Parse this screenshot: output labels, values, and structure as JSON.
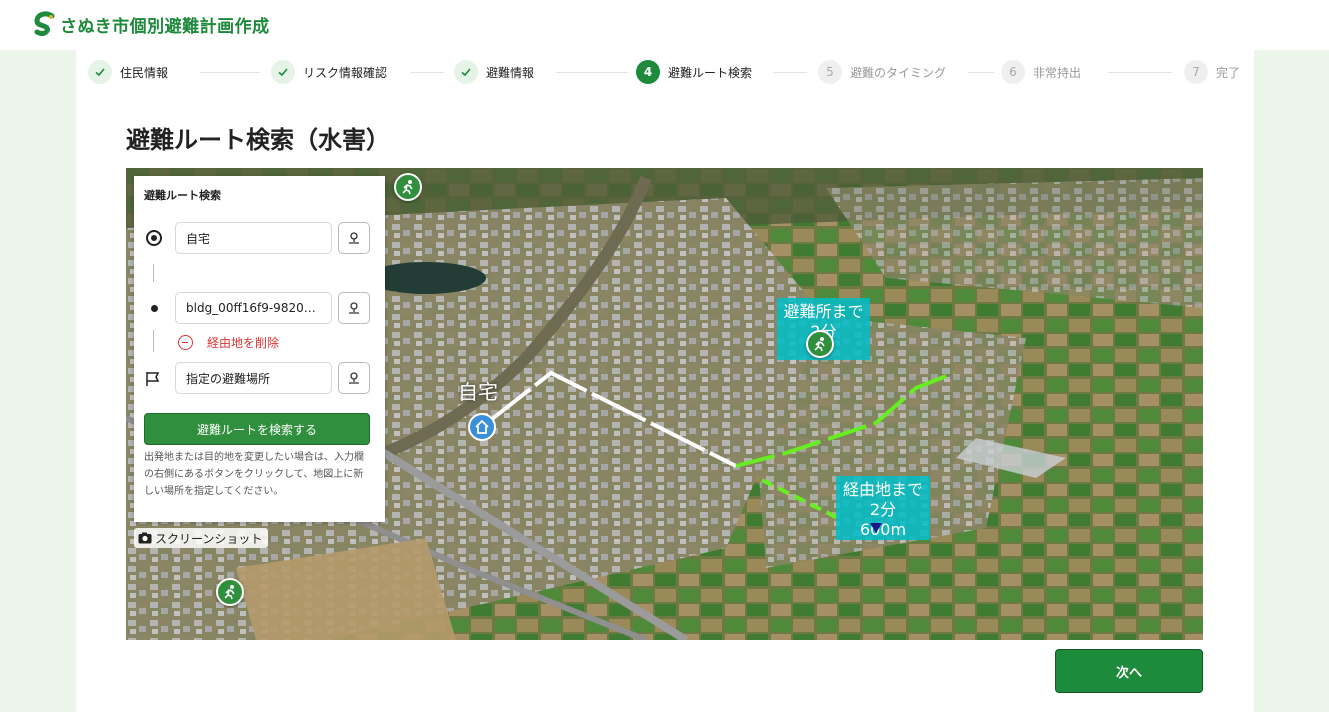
{
  "header": {
    "brand": "さぬき市個別避難計画作成",
    "logo_icon": "sanuki-city-logo-icon"
  },
  "steps": [
    {
      "num": "",
      "label": "住民情報",
      "state": "done"
    },
    {
      "num": "",
      "label": "リスク情報確認",
      "state": "done"
    },
    {
      "num": "",
      "label": "避難情報",
      "state": "done"
    },
    {
      "num": "4",
      "label": "避難ルート検索",
      "state": "current"
    },
    {
      "num": "5",
      "label": "避難のタイミング",
      "state": "todo"
    },
    {
      "num": "6",
      "label": "非常持出",
      "state": "todo"
    },
    {
      "num": "7",
      "label": "完了",
      "state": "todo"
    }
  ],
  "page": {
    "title": "避難ルート検索（水害）"
  },
  "route_panel": {
    "title": "避難ルート検索",
    "origin": "自宅",
    "waypoint": "bldg_00ff16f9-9820…",
    "remove_waypoint": "経由地を削除",
    "destination": "指定の避難場所",
    "search_button": "避難ルートを検索する",
    "help": "出発地または目的地を変更したい場合は、入力欄の右側にあるボタンをクリックして、地図上に新しい場所を指定してください。"
  },
  "map": {
    "home_label": "自宅",
    "shelter_label_line1": "避難所まで",
    "shelter_label_line2": "2分",
    "waypoint_label_line1": "経由地まで",
    "waypoint_label_line2": "2分",
    "waypoint_label_line3": "600m",
    "screenshot_button": "スクリーンショット",
    "route_walked_color": "#ffffff",
    "route_next_color": "#66ee22"
  },
  "footer": {
    "next_button": "次へ"
  },
  "colors": {
    "brand_green": "#1e8a3c",
    "background": "#ebf5ea",
    "danger": "#dd3333"
  }
}
